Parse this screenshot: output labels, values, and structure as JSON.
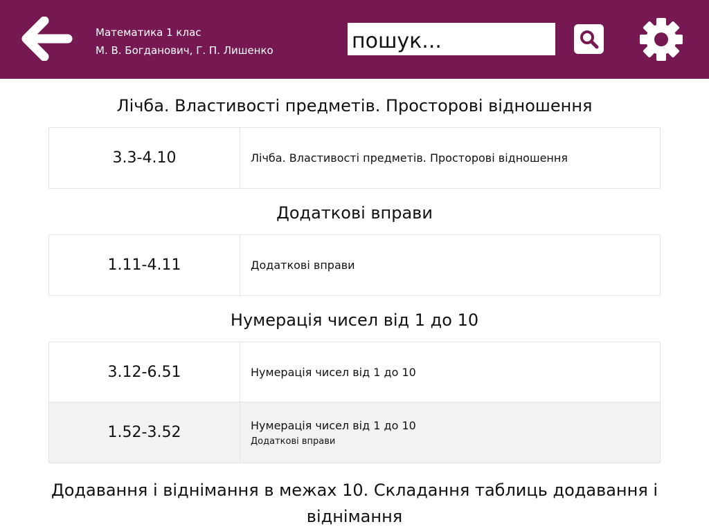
{
  "header": {
    "back_icon": "arrow-left-icon",
    "book_title": "Математика 1 клас",
    "book_authors": "М. В. Богданович, Г. П. Лишенко",
    "search_placeholder": "пошук...",
    "search_icon": "search-icon",
    "settings_icon": "gear-icon",
    "bg_color": "#761952"
  },
  "sections": [
    {
      "title": "Лічба. Властивості предметів. Просторові відношення",
      "rows": [
        {
          "pages": "3.3-4.10",
          "main": "Лічба. Властивості предметів. Просторові відношення"
        }
      ]
    },
    {
      "title": "Додаткові вправи",
      "rows": [
        {
          "pages": "1.11-4.11",
          "main": "Додаткові вправи"
        }
      ]
    },
    {
      "title": "Нумерація чисел від 1 до 10",
      "rows": [
        {
          "pages": "3.12-6.51",
          "main": "Нумерація чисел від 1 до 10"
        },
        {
          "pages": "1.52-3.52",
          "main": "Нумерація чисел від 1 до 10",
          "sub": "Додаткові вправи"
        }
      ]
    },
    {
      "title": "Додавання і віднімання в межах 10. Складання таблиць додавання і віднімання"
    }
  ]
}
